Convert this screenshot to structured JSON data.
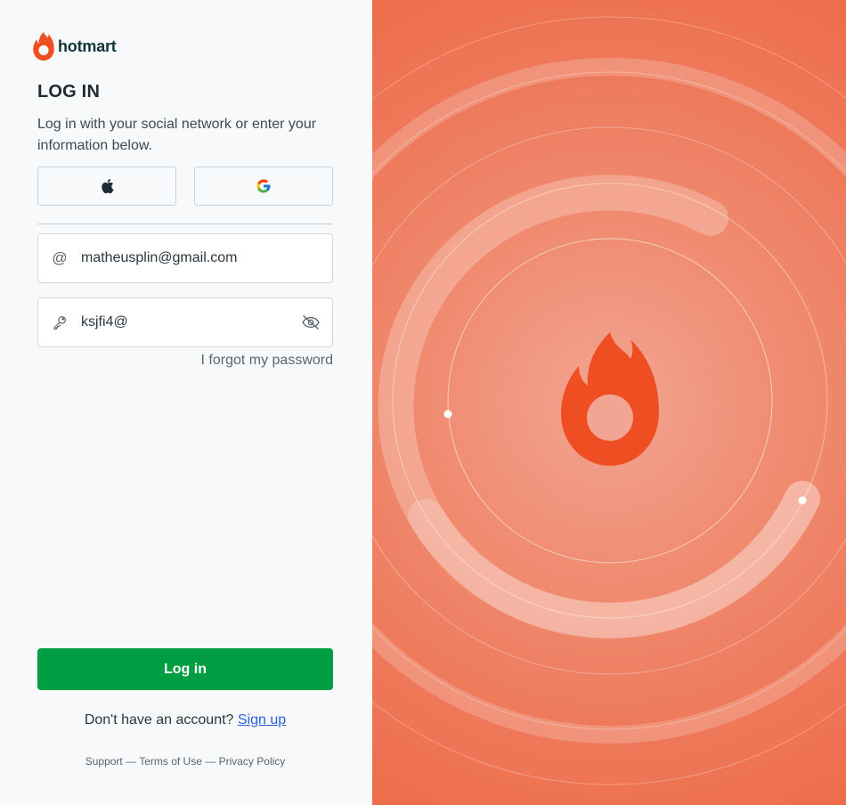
{
  "brand": {
    "name": "hotmart",
    "accent": "#ef4e23",
    "logo_icon": "flame-icon"
  },
  "login": {
    "title": "LOG IN",
    "subtitle": "Log in with your social network or enter your information below.",
    "social": {
      "apple_icon": "apple-icon",
      "google_icon": "google-icon"
    },
    "email": {
      "value": "matheusplin@gmail.com",
      "icon": "at-icon"
    },
    "password": {
      "value": "ksjfi4@",
      "icon": "key-icon",
      "toggle_icon": "eye-off-icon"
    },
    "forgot": "I forgot my password",
    "submit": "Log in",
    "signup_prompt": "Don't have an account?",
    "signup_link": "Sign up",
    "footer": {
      "support": "Support",
      "sep": "—",
      "terms": "Terms of Use",
      "privacy": "Privacy Policy"
    }
  },
  "colors": {
    "primary_button": "#009d43",
    "link": "#2b5fd9",
    "hero_background": "#ee7a5b"
  }
}
